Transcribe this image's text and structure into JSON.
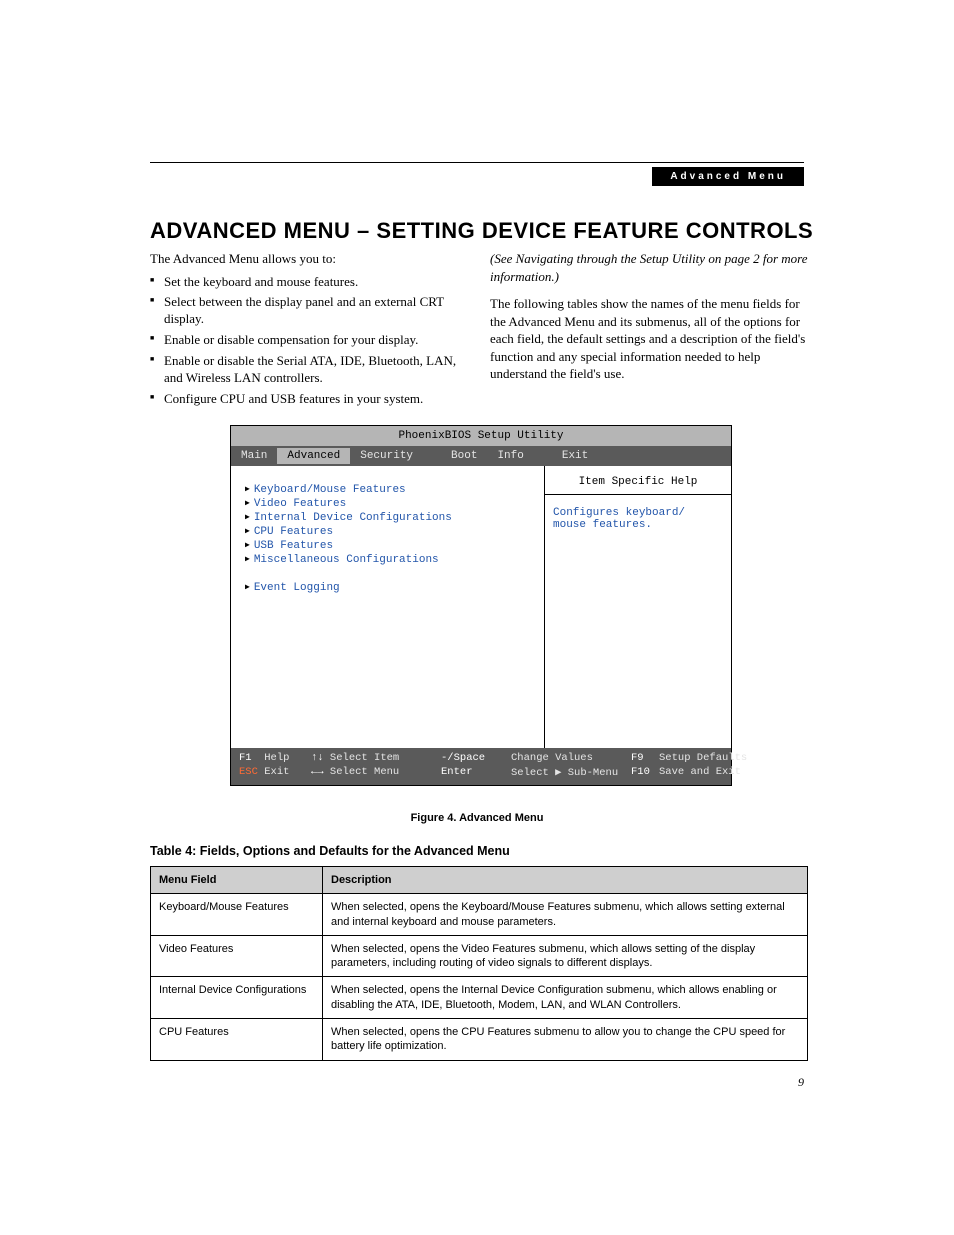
{
  "header_badge": "Advanced Menu",
  "title": "ADVANCED MENU – SETTING DEVICE FEATURE CONTROLS",
  "intro_lead": "The Advanced Menu allows you to:",
  "intro_bullets": [
    "Set the keyboard and mouse features.",
    "Select between the display panel and an external CRT display.",
    "Enable or disable compensation for your display.",
    "Enable or disable the Serial ATA, IDE, Bluetooth, LAN, and Wireless LAN controllers.",
    "Configure CPU and USB features in your system."
  ],
  "right_note": "(See Navigating through the Setup Utility on page 2 for more information.)",
  "right_para": "The following tables show the names of the menu fields for the Advanced Menu and its submenus, all of the options for each field, the default settings and a description of the field's function and any special information needed to help understand the field's use.",
  "bios": {
    "window_title": "PhoenixBIOS Setup Utility",
    "tabs": [
      "Main",
      "Advanced",
      "Security",
      "Boot",
      "Info",
      "Exit"
    ],
    "active_tab": "Advanced",
    "items_group1": [
      "Keyboard/Mouse Features",
      "Video Features",
      "Internal Device Configurations",
      "CPU Features",
      "USB Features",
      "Miscellaneous Configurations"
    ],
    "items_group2": [
      "Event Logging"
    ],
    "help_title": "Item Specific Help",
    "help_text": "Configures keyboard/ mouse features.",
    "footer": {
      "f1": "F1",
      "help": "Help",
      "updown": "↑↓",
      "select_item": "Select Item",
      "minus": "-/Space",
      "change_values": "Change Values",
      "f9": "F9",
      "setup_defaults": "Setup Defaults",
      "esc": "ESC",
      "exit": "Exit",
      "leftright": "←→",
      "select_menu": "Select Menu",
      "enter": "Enter",
      "select_sub": "Select ▶ Sub-Menu",
      "f10": "F10",
      "save_exit": "Save and Exit"
    }
  },
  "figure_caption": "Figure 4.  Advanced Menu",
  "table_title": "Table 4: Fields, Options and Defaults for the Advanced Menu",
  "table_headers": {
    "col1": "Menu Field",
    "col2": "Description"
  },
  "table_rows": [
    {
      "field": "Keyboard/Mouse Features",
      "desc": "When selected, opens the Keyboard/Mouse Features submenu, which allows setting external and internal keyboard and mouse parameters."
    },
    {
      "field": "Video Features",
      "desc": "When selected, opens the Video Features submenu, which allows setting of the display parameters, including routing of video signals to different displays."
    },
    {
      "field": "Internal Device Configurations",
      "desc": "When selected, opens the Internal Device Configuration submenu, which allows enabling or disabling the ATA, IDE, Bluetooth, Modem, LAN, and WLAN Controllers."
    },
    {
      "field": "CPU Features",
      "desc": "When selected, opens the CPU Features submenu to allow you to change the CPU speed for battery life optimization."
    }
  ],
  "page_number": "9"
}
